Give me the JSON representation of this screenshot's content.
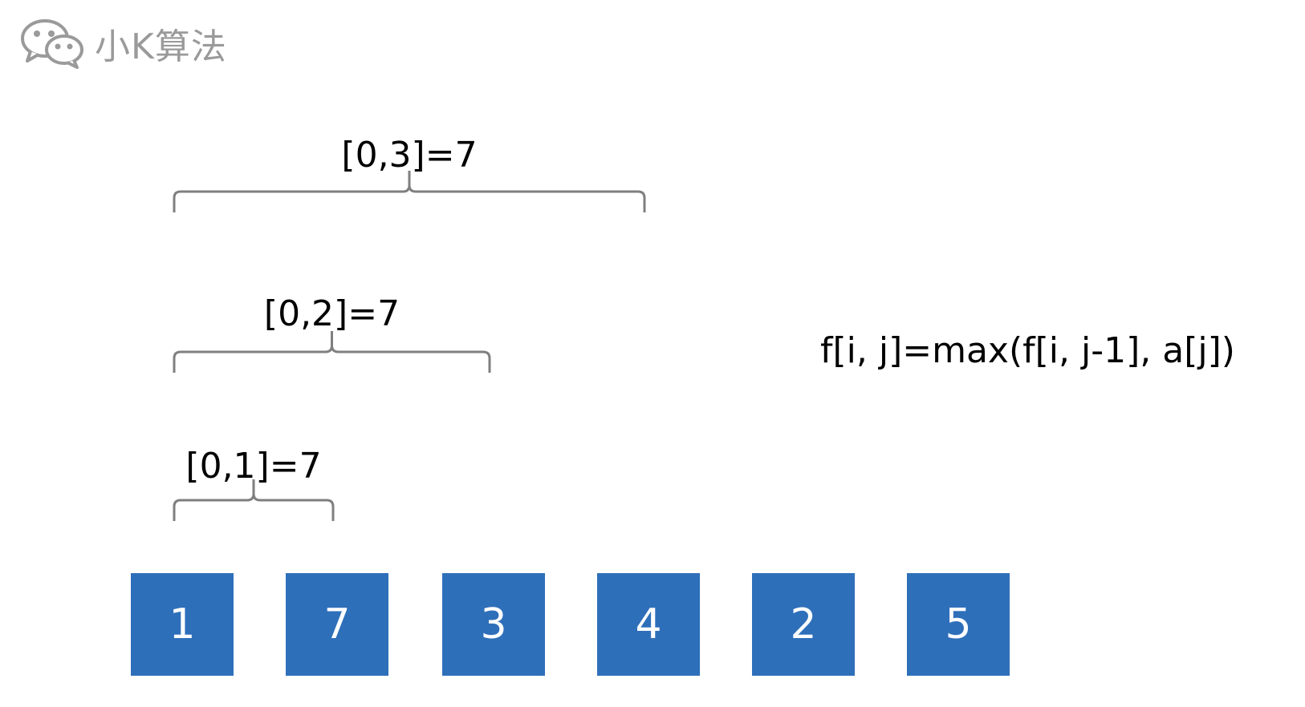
{
  "watermark": {
    "text": "小K算法",
    "icon": "wechat-icon"
  },
  "ranges": [
    {
      "label": "[0,1]=7",
      "from_index": 0,
      "to_index": 1
    },
    {
      "label": "[0,2]=7",
      "from_index": 0,
      "to_index": 2
    },
    {
      "label": "[0,3]=7",
      "from_index": 0,
      "to_index": 3
    }
  ],
  "formula": "f[i, j]=max(f[i, j-1], a[j])",
  "array": [
    "1",
    "7",
    "3",
    "4",
    "2",
    "5"
  ],
  "colors": {
    "cell_fill": "#2e6fba",
    "cell_text": "#ffffff",
    "brace": "#7f7f7f",
    "watermark": "#9a9a9a"
  }
}
